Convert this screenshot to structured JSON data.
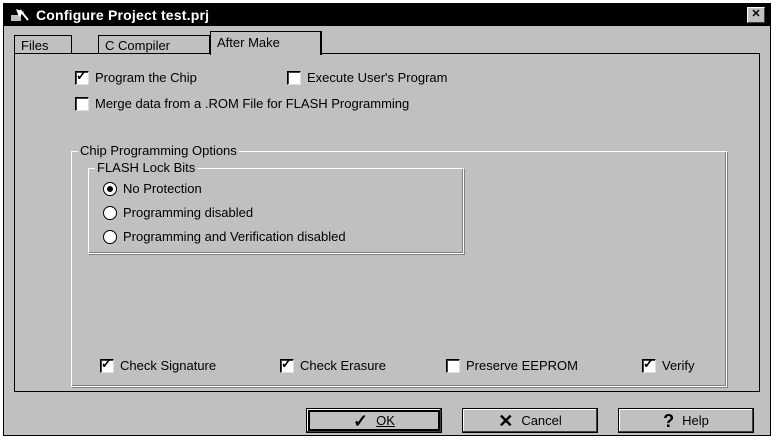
{
  "window": {
    "title": "Configure Project test.prj",
    "close_label": "✕"
  },
  "tabs": [
    {
      "label": "Files"
    },
    {
      "label": "C Compiler"
    },
    {
      "label": "After Make"
    }
  ],
  "options": {
    "program_chip": {
      "label": "Program the Chip",
      "checked": true
    },
    "execute_program": {
      "label": "Execute User's Program",
      "checked": false
    },
    "merge_rom": {
      "label": "Merge data from a .ROM File for FLASH Programming",
      "checked": false
    }
  },
  "chip_programming": {
    "label": "Chip Programming Options",
    "lock_bits": {
      "label": "FLASH Lock Bits",
      "items": [
        {
          "label": "No Protection",
          "selected": true
        },
        {
          "label": "Programming disabled",
          "selected": false
        },
        {
          "label": "Programming and Verification disabled",
          "selected": false
        }
      ]
    },
    "checks": [
      {
        "label": "Check Signature",
        "checked": true
      },
      {
        "label": "Check Erasure",
        "checked": true
      },
      {
        "label": "Preserve EEPROM",
        "checked": false
      },
      {
        "label": "Verify",
        "checked": true
      }
    ]
  },
  "buttons": {
    "ok": {
      "label": "OK",
      "icon": "checkmark-icon"
    },
    "cancel": {
      "label": "Cancel",
      "icon": "x-icon"
    },
    "help": {
      "label": "Help",
      "icon": "question-icon"
    }
  }
}
